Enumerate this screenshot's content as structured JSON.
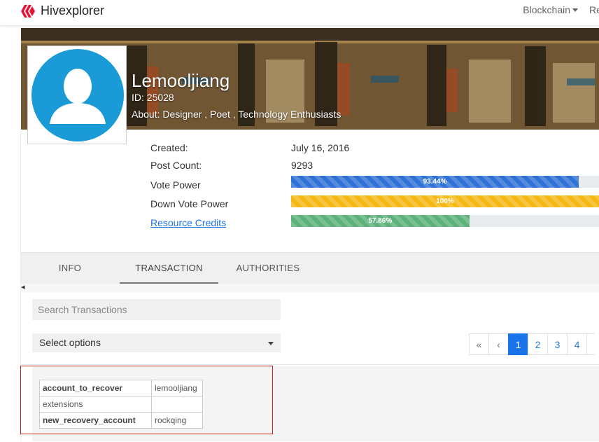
{
  "nav": {
    "brand": "Hivexplorer",
    "menu": [
      {
        "label": "Blockchain",
        "has_caret": true
      },
      {
        "label": "Re",
        "has_caret": false
      }
    ]
  },
  "profile": {
    "name": "Lemooljiang",
    "id_line": "ID: 25028",
    "about_line": "About: Designer , Poet , Technology Enthusiasts",
    "avatar_icon": "default-user-icon",
    "stats": [
      {
        "label": "Created:",
        "value": "July 16, 2016"
      },
      {
        "label": "Post Count:",
        "value": "9293"
      }
    ],
    "bars": [
      {
        "label": "Vote Power",
        "text": "93.44%",
        "fraction": 0.9344,
        "color": "#2f72d6",
        "is_link": false
      },
      {
        "label": "Down Vote Power",
        "text": "100%",
        "fraction": 1.0,
        "color": "#f5b914",
        "is_link": false
      },
      {
        "label": "Resource Credits",
        "text": "57.86%",
        "fraction": 0.5786,
        "color": "#5cb27a",
        "is_link": true
      }
    ]
  },
  "tabs": [
    {
      "label": "INFO",
      "active": false
    },
    {
      "label": "TRANSACTION",
      "active": true
    },
    {
      "label": "AUTHORITIES",
      "active": false
    }
  ],
  "search": {
    "placeholder": "Search Transactions",
    "value": ""
  },
  "filter": {
    "selected": "Select options"
  },
  "pagination": {
    "prev_all": "«",
    "prev": "‹",
    "pages": [
      "1",
      "2",
      "3",
      "4"
    ],
    "current": "1"
  },
  "transaction": {
    "rows": [
      {
        "key": "account_to_recover",
        "value": "lemooljiang",
        "bold": true
      },
      {
        "key": "extensions",
        "value": "",
        "bold": false
      },
      {
        "key": "new_recovery_account",
        "value": "rockqing",
        "bold": true
      }
    ]
  },
  "colors": {
    "accent": "#1a73e8",
    "brand": "#e31337",
    "avatar_bg": "#1a9ad6",
    "highlight_outline": "#cc1f1f"
  }
}
